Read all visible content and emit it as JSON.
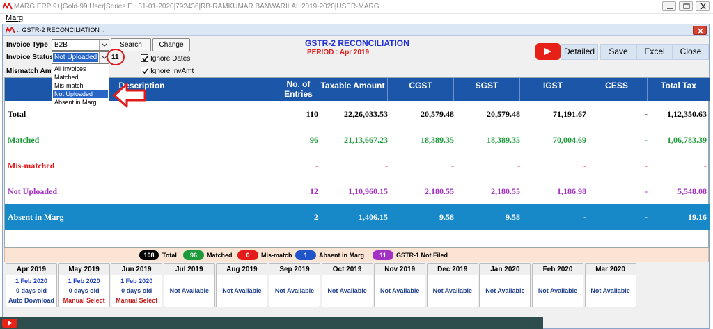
{
  "app": {
    "title": "MARG ERP 9+|Gold-99 User|Series E+ 31-01-2020|792436|RB-RAMKUMAR BANWARILAL 2019-2020|USER-MARG",
    "menu": [
      "Marg"
    ]
  },
  "window": {
    "title": ":: GSTR-2 RECONCILIATION ::",
    "heading": "GSTR-2 RECONCILIATION",
    "period_label": "PERIOD :",
    "period_value": "Apr 2019"
  },
  "filters": {
    "invoice_type_label": "Invoice Type",
    "invoice_type_value": "B2B",
    "search_label": "Search",
    "change_label": "Change",
    "invoice_status_label": "Invoice Status",
    "invoice_status_value": "Not Uploaded",
    "status_count": "11",
    "mismatch_label": "Mismatch Amt",
    "ignore_dates_label": "Ignore Dates",
    "ignore_inv_label": "Ignore InvAmt",
    "status_options": [
      "All Invoices",
      "Matched",
      "Mis-match",
      "Not Uploaded",
      "Absent in Marg"
    ]
  },
  "actions": {
    "detailed": "Detailed",
    "save": "Save",
    "excel": "Excel",
    "close": "Close"
  },
  "table": {
    "headers": [
      "Description",
      "No. of\nEntries",
      "Taxable Amount",
      "CGST",
      "SGST",
      "IGST",
      "CESS",
      "Total Tax"
    ],
    "rows": [
      {
        "desc": "Total",
        "entries": "110",
        "taxable": "22,26,033.53",
        "cgst": "20,579.48",
        "sgst": "20,579.48",
        "igst": "71,191.67",
        "cess": "-",
        "total": "1,12,350.63"
      },
      {
        "desc": "Matched",
        "entries": "96",
        "taxable": "21,13,667.23",
        "cgst": "18,389.35",
        "sgst": "18,389.35",
        "igst": "70,004.69",
        "cess": "-",
        "total": "1,06,783.39"
      },
      {
        "desc": "Mis-matched",
        "entries": "-",
        "taxable": "-",
        "cgst": "-",
        "sgst": "-",
        "igst": "-",
        "cess": "-",
        "total": "-"
      },
      {
        "desc": "Not Uploaded",
        "entries": "12",
        "taxable": "1,10,960.15",
        "cgst": "2,180.55",
        "sgst": "2,180.55",
        "igst": "1,186.98",
        "cess": "-",
        "total": "5,548.08"
      },
      {
        "desc": "Absent in Marg",
        "entries": "2",
        "taxable": "1,406.15",
        "cgst": "9.58",
        "sgst": "9.58",
        "igst": "-",
        "cess": "-",
        "total": "19.16"
      }
    ],
    "row_colors": [
      "#000000",
      "#1e9a3c",
      "#e31b1b",
      "#a531c4",
      "#ffffff"
    ]
  },
  "legend": [
    {
      "count": "108",
      "label": "Total",
      "color": "#000000"
    },
    {
      "count": "96",
      "label": "Matched",
      "color": "#1e9a3c"
    },
    {
      "count": "0",
      "label": "Mis-match",
      "color": "#e31b1b"
    },
    {
      "count": "1",
      "label": "Absent in Marg",
      "color": "#1f55c9"
    },
    {
      "count": "11",
      "label": "GSTR-1 Not Filed",
      "color": "#a531c4"
    }
  ],
  "months": [
    {
      "name": "Apr 2019",
      "l1": "1 Feb 2020",
      "l2": "0 days old",
      "l3": "Auto Download"
    },
    {
      "name": "May 2019",
      "l1": "1 Feb 2020",
      "l2": "0 days old",
      "l3": "Manual Select"
    },
    {
      "name": "Jun 2019",
      "l1": "1 Feb 2020",
      "l2": "0 days old",
      "l3": "Manual Select"
    },
    {
      "name": "Jul 2019",
      "status": "Not Available"
    },
    {
      "name": "Aug 2019",
      "status": "Not Available"
    },
    {
      "name": "Sep 2019",
      "status": "Not Available"
    },
    {
      "name": "Oct 2019",
      "status": "Not Available"
    },
    {
      "name": "Nov 2019",
      "status": "Not Available"
    },
    {
      "name": "Dec 2019",
      "status": "Not Available"
    },
    {
      "name": "Jan 2020",
      "status": "Not Available"
    },
    {
      "name": "Feb 2020",
      "status": "Not Available"
    },
    {
      "name": "Mar 2020",
      "status": "Not Available"
    }
  ],
  "colors": {
    "header_blue": "#1b56a8",
    "absent_row_bg": "#1789c8",
    "annotation_red": "#e01b1b"
  }
}
